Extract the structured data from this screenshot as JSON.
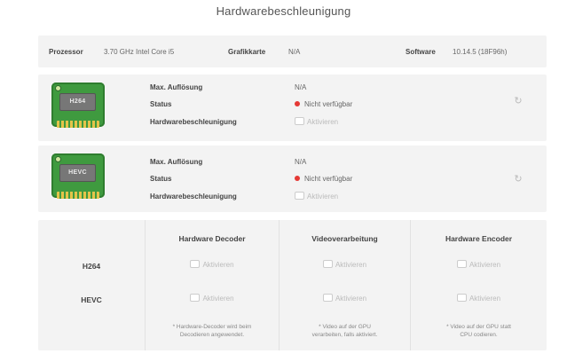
{
  "title": "Hardwarebeschleunigung",
  "info": {
    "processor_label": "Prozessor",
    "processor_value": "3.70 GHz Intel Core i5",
    "graphics_label": "Grafikkarte",
    "graphics_value": "N/A",
    "software_label": "Software",
    "software_value": "10.14.5 (18F96h)"
  },
  "codecs": [
    {
      "chip_label": "H264",
      "max_res_label": "Max. Auflösung",
      "max_res_value": "N/A",
      "status_label": "Status",
      "status_value": "Nicht verfügbar",
      "hw_label": "Hardwarebeschleunigung",
      "activate_label": "Aktivieren"
    },
    {
      "chip_label": "HEVC",
      "max_res_label": "Max. Auflösung",
      "max_res_value": "N/A",
      "status_label": "Status",
      "status_value": "Nicht verfügbar",
      "hw_label": "Hardwarebeschleunigung",
      "activate_label": "Aktivieren"
    }
  ],
  "matrix": {
    "columns": [
      "Hardware Decoder",
      "Videoverarbeitung",
      "Hardware Encoder"
    ],
    "rows": [
      "H264",
      "HEVC"
    ],
    "activate_label": "Aktivieren",
    "footnotes": [
      [
        "* Hardware-Decoder wird beim",
        "Decodieren angewendet."
      ],
      [
        "* Video auf der GPU",
        "verarbeiten, falls aktiviert."
      ],
      [
        "* Video auf der GPU statt",
        "CPU codieren."
      ]
    ]
  },
  "colors": {
    "status_unavailable": "#e53935",
    "chip_green": "#3f9a3f",
    "panel_bg": "#f3f3f3"
  }
}
